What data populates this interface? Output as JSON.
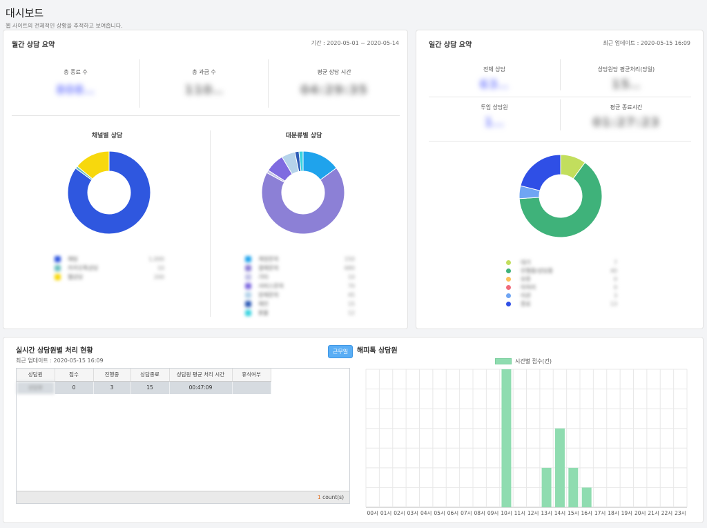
{
  "page": {
    "title": "대시보드",
    "subtitle": "웹 사이트의 전체적인 상황을 추적하고 보여줍니다."
  },
  "monthly": {
    "title": "월간 상담 요약",
    "period": "기간 : 2020-05-01 ~ 2020-05-14",
    "stats": [
      {
        "label": "총 종료 수",
        "value": "808..",
        "color": "#7d86ff"
      },
      {
        "label": "총 과금 수",
        "value": "110..",
        "color": "#888"
      },
      {
        "label": "평균 상담 시간",
        "value": "04:29:35",
        "color": "#888"
      }
    ],
    "channel": {
      "title": "채널별 상담",
      "legend": [
        {
          "label": "채팅",
          "value": "1,000",
          "color": "#2f57df"
        },
        {
          "label": "카카오톡상담",
          "value": "10",
          "color": "#6fc0c0"
        },
        {
          "label": "웹상담",
          "value": "200",
          "color": "#f7d80d"
        }
      ]
    },
    "category": {
      "title": "대분류별 상담",
      "legend": [
        {
          "label": "계정문의",
          "value": "150",
          "color": "#1fa3ec"
        },
        {
          "label": "결제문의",
          "value": "680",
          "color": "#8c80d6"
        },
        {
          "label": "기타",
          "value": "10",
          "color": "#c5c5e8"
        },
        {
          "label": "서비스문의",
          "value": "70",
          "color": "#7f6be0"
        },
        {
          "label": "장애문의",
          "value": "45",
          "color": "#b5d3ea"
        },
        {
          "label": "제안",
          "value": "15",
          "color": "#2d5bb6"
        },
        {
          "label": "환불",
          "value": "12",
          "color": "#39d3e0"
        }
      ]
    }
  },
  "daily": {
    "title": "일간 상담 요약",
    "updated": "최근 업데이트 : 2020-05-15 16:09",
    "stats": [
      {
        "label": "전체 상담",
        "value": "63..",
        "color": "#7d86ff"
      },
      {
        "label": "상담원당 평균처리(당일)",
        "value": "15..",
        "color": "#888"
      },
      {
        "label": "투입 상담원",
        "value": "1..",
        "color": "#7d86ff"
      },
      {
        "label": "평균 종료시간",
        "value": "01:27:23",
        "color": "#888"
      }
    ],
    "legend": [
      {
        "label": "대기",
        "value": "7",
        "color": "#c2de5d"
      },
      {
        "label": "진행중/상담중",
        "value": "40",
        "color": "#3fb27a"
      },
      {
        "label": "보류",
        "value": "0",
        "color": "#fbc05a"
      },
      {
        "label": "미처리",
        "value": "0",
        "color": "#f06a7a"
      },
      {
        "label": "이관",
        "value": "3",
        "color": "#6fa5f3"
      },
      {
        "label": "종료",
        "value": "13",
        "color": "#2f4fe6"
      }
    ]
  },
  "realtime": {
    "title": "실시간 상담원별 처리 현황",
    "updated": "최근 업데이트 : 2020-05-15 16:09",
    "work_button": "근무일",
    "columns": [
      "상담원",
      "접수",
      "진행중",
      "상담종료",
      "상담원 평균 처리 시간",
      "휴식여부"
    ],
    "rows": [
      {
        "agent": "상담원",
        "received": "0",
        "in_progress": "3",
        "done": "15",
        "avg_time": "00:47:09",
        "rest": ""
      }
    ],
    "count_num": "1",
    "count_label": " count(s)"
  },
  "happytalk": {
    "title": "해피톡 상담원",
    "legend": "시간별 접수(건)"
  },
  "chart_data": {
    "type": "bar",
    "title": "",
    "series": [
      {
        "name": "시간별 접수(건)",
        "values": [
          0,
          0,
          0,
          0,
          0,
          0,
          0,
          0,
          0,
          0,
          7,
          0,
          0,
          2,
          4,
          2,
          1,
          0,
          0,
          0,
          0,
          0,
          0,
          0
        ]
      }
    ],
    "categories": [
      "00시",
      "01시",
      "02시",
      "03시",
      "04시",
      "05시",
      "06시",
      "07시",
      "08시",
      "09시",
      "10시",
      "11시",
      "12시",
      "13시",
      "14시",
      "15시",
      "16시",
      "17시",
      "18시",
      "19시",
      "20시",
      "21시",
      "22시",
      "23시"
    ],
    "ylim": [
      0,
      7
    ],
    "color": "#8fdcb0",
    "grid": true
  },
  "donuts": {
    "channel": [
      85,
      1,
      14
    ],
    "category": [
      14,
      64,
      1,
      7,
      5,
      1.5,
      1.5
    ],
    "daily": [
      10,
      64,
      0,
      0,
      5,
      21
    ]
  }
}
